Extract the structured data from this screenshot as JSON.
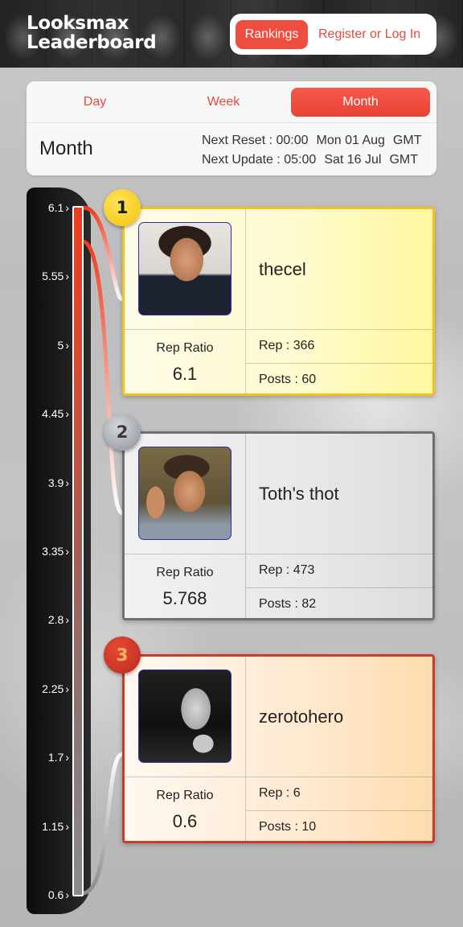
{
  "header": {
    "brand_line1": "Looksmax",
    "brand_line2": "Leaderboard",
    "nav": {
      "rankings": "Rankings",
      "login": "Register or Log In"
    }
  },
  "period": {
    "tabs": [
      "Day",
      "Week",
      "Month"
    ],
    "active_tab": "Month",
    "title": "Month",
    "next_reset": {
      "label": "Next Reset : 00:00",
      "date": "Mon 01 Aug",
      "tz": "GMT"
    },
    "next_update": {
      "label": "Next Update : 05:00",
      "date": "Sat 16 Jul",
      "tz": "GMT"
    }
  },
  "scale": {
    "ticks": [
      "6.1",
      "5.55",
      "5",
      "4.45",
      "3.9",
      "3.35",
      "2.8",
      "2.25",
      "1.7",
      "1.15",
      "0.6"
    ],
    "max": 6.1,
    "min": 0.6
  },
  "leaders": [
    {
      "rank": "1",
      "name": "thecel",
      "ratio_label": "Rep Ratio",
      "ratio": "6.1",
      "rep": "Rep : 366",
      "posts": "Posts : 60",
      "tier": "gold"
    },
    {
      "rank": "2",
      "name": "Toth's thot",
      "ratio_label": "Rep Ratio",
      "ratio": "5.768",
      "rep": "Rep : 473",
      "posts": "Posts : 82",
      "tier": "silver"
    },
    {
      "rank": "3",
      "name": "zerotohero",
      "ratio_label": "Rep Ratio",
      "ratio": "0.6",
      "rep": "Rep : 6",
      "posts": "Posts : 10",
      "tier": "bronze"
    }
  ],
  "colors": {
    "accent": "#ef4e3e",
    "gold": "#f3c021",
    "silver": "#6e7075",
    "bronze": "#cc3a2a"
  }
}
